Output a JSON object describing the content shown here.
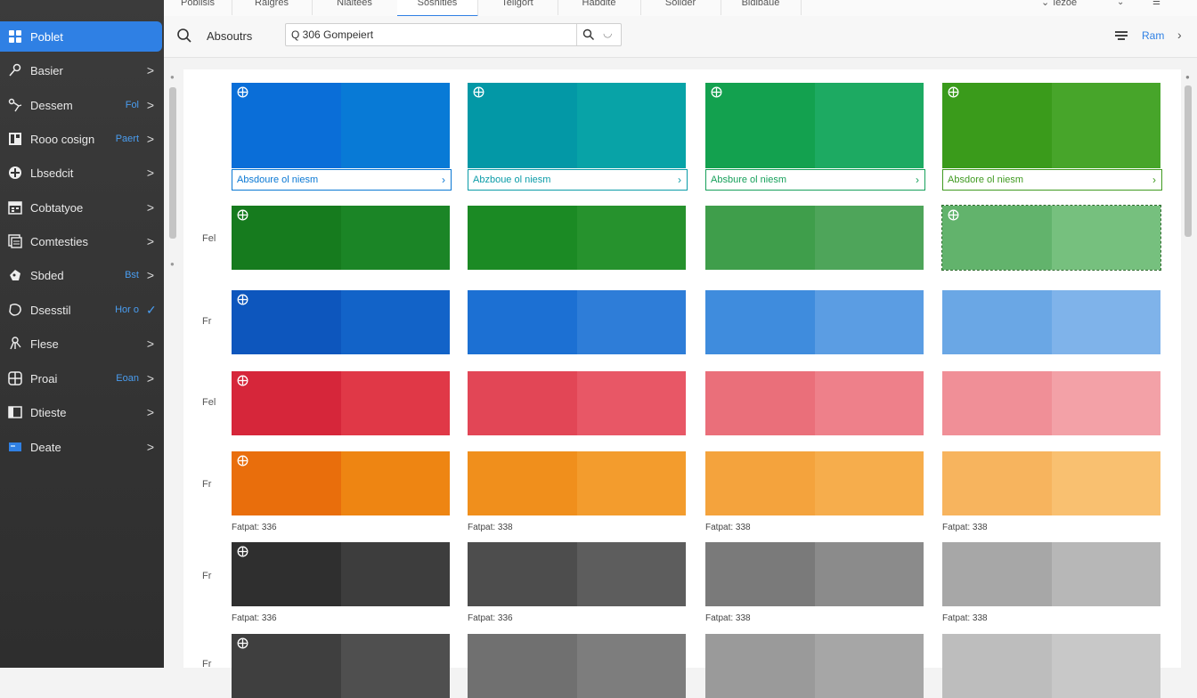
{
  "tabs": [
    "Poblisis",
    "Raigres",
    "Nialtees",
    "Soshities",
    "Teilgort",
    "Habdite",
    "Solider",
    "Bidibaue"
  ],
  "tab_right": {
    "label": "Iezoe"
  },
  "sidebar": {
    "items": [
      {
        "label": "Poblet",
        "icon": "grid-icon",
        "badge": "",
        "chevron": "",
        "active": true
      },
      {
        "label": "Basier",
        "icon": "pin-icon",
        "badge": "",
        "chevron": ">"
      },
      {
        "label": "Dessem",
        "icon": "node-icon",
        "badge": "Fol",
        "chevron": ">"
      },
      {
        "label": "Rooo cosign",
        "icon": "layout-icon",
        "badge": "Paert",
        "chevron": ">"
      },
      {
        "label": "Lbsedcit",
        "icon": "add-circle-icon",
        "badge": "",
        "chevron": ">"
      },
      {
        "label": "Cobtatyoe",
        "icon": "calendar-icon",
        "badge": "",
        "chevron": ">"
      },
      {
        "label": "Comtesties",
        "icon": "document-icon",
        "badge": "",
        "chevron": ">"
      },
      {
        "label": "Sbded",
        "icon": "palette-icon",
        "badge": "Bst",
        "chevron": ">"
      },
      {
        "label": "Dsesstil",
        "icon": "shape-icon",
        "badge": "Hor o",
        "chevron": "✓"
      },
      {
        "label": "Flese",
        "icon": "hierarchy-icon",
        "badge": "",
        "chevron": ">"
      },
      {
        "label": "Proai",
        "icon": "globe-icon",
        "badge": "Eoan",
        "chevron": ">"
      },
      {
        "label": "Dtieste",
        "icon": "folder-icon",
        "badge": "",
        "chevron": ">"
      },
      {
        "label": "Deate",
        "icon": "window-icon",
        "badge": "",
        "chevron": ">"
      }
    ]
  },
  "toolbar": {
    "label": "Absoutrs",
    "search_value": "Q 306 Gompeiert",
    "right_label": "Ram"
  },
  "palette": {
    "first_row_labels": [
      "Absdoure ol niesm",
      "Abzboue ol niesm",
      "Absbure ol niesm",
      "Absdore ol niesm"
    ],
    "label_colors": [
      "#0a78d4",
      "#0b9ca8",
      "#16a05a",
      "#3f9a20"
    ],
    "row_marks": [
      "Fel",
      "Fr",
      "Fel",
      "Fr",
      "Fr",
      "Fr"
    ],
    "captions_orange": [
      "Fatpat: 336",
      "Fatpat: 338",
      "Fatpat: 338",
      "Fatpat: 338"
    ],
    "captions_gray": [
      "Fatpat: 336",
      "Fatpat: 336",
      "Fatpat: 338",
      "Fatpat: 338"
    ],
    "rows": [
      [
        [
          "#0a6ed8",
          "#087ad6"
        ],
        [
          "#0398a6",
          "#08a3a7"
        ],
        [
          "#13a14f",
          "#1daa62"
        ],
        [
          "#3a9b1b",
          "#47a52a"
        ]
      ],
      [
        [
          "#167b1e",
          "#1b8526"
        ],
        [
          "#1b8a24",
          "#26922d"
        ],
        [
          "#3f9e4b",
          "#4ea55a"
        ],
        [
          "#62b36c",
          "#76c07e"
        ]
      ],
      [
        [
          "#0d56bd",
          "#1263c8"
        ],
        [
          "#1c70d3",
          "#2e7dd8"
        ],
        [
          "#3f8cdd",
          "#5b9de3"
        ],
        [
          "#6aa7e5",
          "#7fb3ea"
        ]
      ],
      [
        [
          "#d6263a",
          "#e03847"
        ],
        [
          "#e24656",
          "#e85766"
        ],
        [
          "#ea6f7a",
          "#ee808a"
        ],
        [
          "#f08f97",
          "#f3a1a7"
        ]
      ],
      [
        [
          "#e96e0c",
          "#ee8512"
        ],
        [
          "#f08f1c",
          "#f39c2d"
        ],
        [
          "#f4a33d",
          "#f6ad4c"
        ],
        [
          "#f7b45e",
          "#f9c070"
        ]
      ],
      [
        [
          "#2f2f2f",
          "#3d3d3d"
        ],
        [
          "#4d4d4d",
          "#5d5d5d"
        ],
        [
          "#7a7a7a",
          "#8b8b8b"
        ],
        [
          "#a7a7a7",
          "#b7b7b7"
        ]
      ],
      [
        [
          "#3f3f3f",
          "#4f4f4f"
        ],
        [
          "#707070",
          "#7d7d7d"
        ],
        [
          "#9a9a9a",
          "#a6a6a6"
        ],
        [
          "#bdbdbd",
          "#c8c8c8"
        ]
      ]
    ]
  }
}
